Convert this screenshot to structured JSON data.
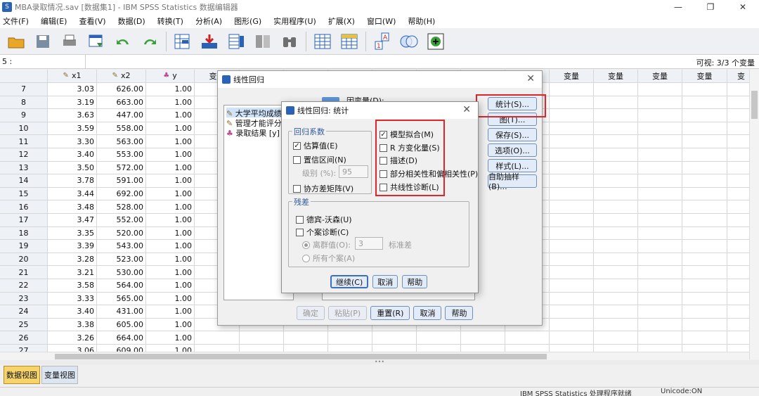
{
  "window": {
    "title": "MBA录取情况.sav [数据集1] - IBM SPSS Statistics 数据编辑器",
    "minimize": "—",
    "restore": "❐",
    "close": "✕"
  },
  "menu": [
    "文件(F)",
    "编辑(E)",
    "查看(V)",
    "数据(D)",
    "转换(T)",
    "分析(A)",
    "图形(G)",
    "实用程序(U)",
    "扩展(X)",
    "窗口(W)",
    "帮助(H)"
  ],
  "toolbar_icons": [
    "open-icon",
    "save-icon",
    "print-icon",
    "recall-dialog-icon",
    "undo-icon",
    "redo-icon",
    "goto-case-icon",
    "goto-variable-icon",
    "variables-icon",
    "split-file-icon",
    "find-icon",
    "insert-cases-icon",
    "select-cases-icon",
    "value-labels-icon",
    "use-sets-icon",
    "show-all-icon"
  ],
  "cellbar": {
    "ref": "5 :",
    "visible": "可视: 3/3 个变量"
  },
  "grid": {
    "columns": [
      "x1",
      "x2",
      "y",
      "变量",
      "变量",
      "变量",
      "变量",
      "变量",
      "变量",
      "变量",
      "变量",
      "变量",
      "变量",
      "变量",
      "变量",
      "变"
    ],
    "rows": [
      {
        "n": "7",
        "x1": "3.03",
        "x2": "626.00",
        "y": "1.00"
      },
      {
        "n": "8",
        "x1": "3.19",
        "x2": "663.00",
        "y": "1.00"
      },
      {
        "n": "9",
        "x1": "3.63",
        "x2": "447.00",
        "y": "1.00"
      },
      {
        "n": "10",
        "x1": "3.59",
        "x2": "558.00",
        "y": "1.00"
      },
      {
        "n": "11",
        "x1": "3.30",
        "x2": "563.00",
        "y": "1.00"
      },
      {
        "n": "12",
        "x1": "3.40",
        "x2": "553.00",
        "y": "1.00"
      },
      {
        "n": "13",
        "x1": "3.50",
        "x2": "572.00",
        "y": "1.00"
      },
      {
        "n": "14",
        "x1": "3.78",
        "x2": "591.00",
        "y": "1.00"
      },
      {
        "n": "15",
        "x1": "3.44",
        "x2": "692.00",
        "y": "1.00"
      },
      {
        "n": "16",
        "x1": "3.48",
        "x2": "528.00",
        "y": "1.00"
      },
      {
        "n": "17",
        "x1": "3.47",
        "x2": "552.00",
        "y": "1.00"
      },
      {
        "n": "18",
        "x1": "3.35",
        "x2": "520.00",
        "y": "1.00"
      },
      {
        "n": "19",
        "x1": "3.39",
        "x2": "543.00",
        "y": "1.00"
      },
      {
        "n": "20",
        "x1": "3.28",
        "x2": "523.00",
        "y": "1.00"
      },
      {
        "n": "21",
        "x1": "3.21",
        "x2": "530.00",
        "y": "1.00"
      },
      {
        "n": "22",
        "x1": "3.58",
        "x2": "564.00",
        "y": "1.00"
      },
      {
        "n": "23",
        "x1": "3.33",
        "x2": "565.00",
        "y": "1.00"
      },
      {
        "n": "24",
        "x1": "3.40",
        "x2": "431.00",
        "y": "1.00"
      },
      {
        "n": "25",
        "x1": "3.38",
        "x2": "605.00",
        "y": "1.00"
      },
      {
        "n": "26",
        "x1": "3.26",
        "x2": "664.00",
        "y": "1.00"
      },
      {
        "n": "27",
        "x1": "3.06",
        "x2": "609.00",
        "y": "1.00"
      }
    ]
  },
  "view_tabs": [
    "数据视图",
    "变量视图"
  ],
  "status": {
    "processor": "IBM SPSS Statistics 处理程序就绪",
    "unicode": "Unicode:ON"
  },
  "outer_dialog": {
    "title": "线性回归",
    "close": "✕",
    "variables": [
      "大学平均成绩",
      "管理才能评分",
      "录取结果 [y]"
    ],
    "dependent_label": "因变量(D):",
    "side_buttons": [
      "统计(S)...",
      "图(T)...",
      "保存(S)...",
      "选项(O)...",
      "样式(L)...",
      "自助抽样(B)..."
    ],
    "footer_buttons": [
      "确定",
      "粘贴(P)",
      "重置(R)",
      "取消",
      "帮助"
    ]
  },
  "inner_dialog": {
    "title": "线性回归: 统计",
    "close": "✕",
    "coef_group": "回归系数",
    "estimates": "估算值(E)",
    "conf_intervals": "置信区间(N)",
    "level_label": "级别 (%):",
    "level_value": "95",
    "cov_matrix": "协方差矩阵(V)",
    "model_fit": "模型拟合(M)",
    "r_change": "R 方变化量(S)",
    "descriptives": "描述(D)",
    "part_partial": "部分相关性和偏相关性(P)",
    "collinearity": "共线性诊断(L)",
    "residuals_group": "残差",
    "durbin": "德宾-沃森(U)",
    "casewise": "个案诊断(C)",
    "outliers": "离群值(O):",
    "outliers_value": "3",
    "std_dev": "标准差",
    "all_cases": "所有个案(A)",
    "continue": "继续(C)",
    "cancel": "取消",
    "help": "帮助",
    "check": "✓"
  }
}
